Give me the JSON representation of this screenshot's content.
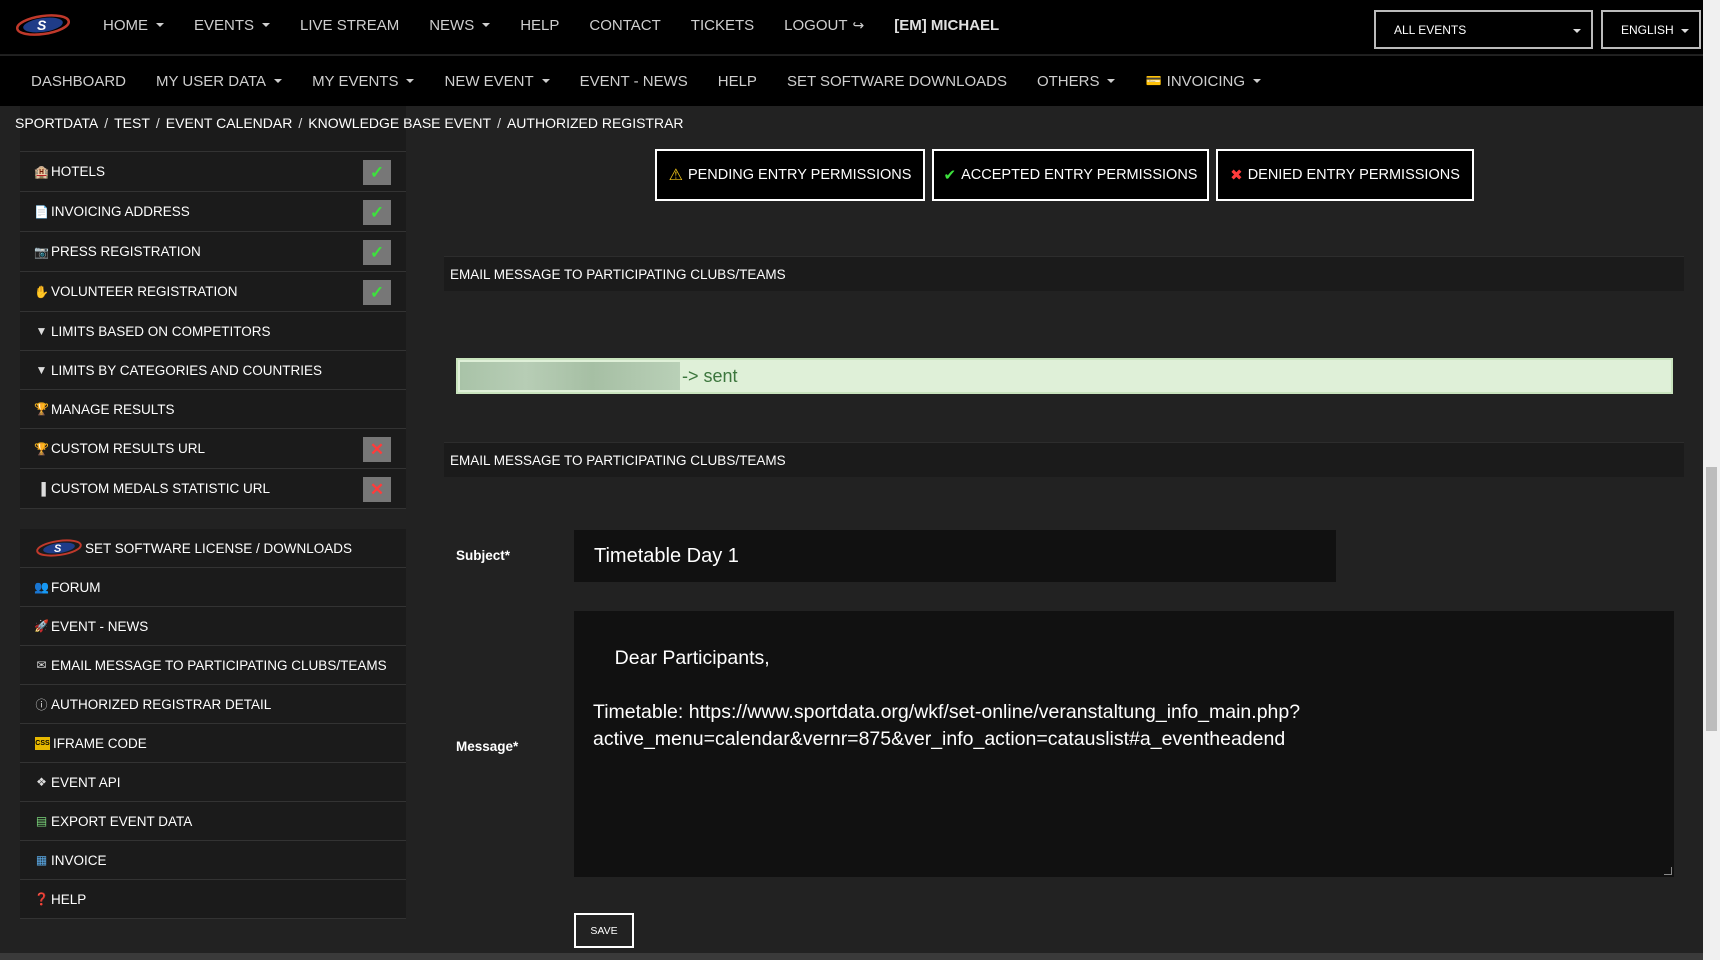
{
  "topnav": {
    "items": [
      {
        "label": "HOME",
        "dropdown": true
      },
      {
        "label": "EVENTS",
        "dropdown": true
      },
      {
        "label": "LIVE STREAM",
        "dropdown": false
      },
      {
        "label": "NEWS",
        "dropdown": true
      },
      {
        "label": "HELP",
        "dropdown": false
      },
      {
        "label": "CONTACT",
        "dropdown": false
      },
      {
        "label": "TICKETS",
        "dropdown": false
      },
      {
        "label": "LOGOUT",
        "dropdown": false
      },
      {
        "label": "[EM] MICHAEL",
        "dropdown": false
      }
    ],
    "event_select": "ALL EVENTS",
    "language_select": "ENGLISH"
  },
  "subnav": {
    "items": [
      {
        "label": "DASHBOARD",
        "dropdown": false
      },
      {
        "label": "MY USER DATA",
        "dropdown": true
      },
      {
        "label": "MY EVENTS",
        "dropdown": true
      },
      {
        "label": "NEW EVENT",
        "dropdown": true
      },
      {
        "label": "EVENT - NEWS",
        "dropdown": false
      },
      {
        "label": "HELP",
        "dropdown": false
      },
      {
        "label": "SET SOFTWARE DOWNLOADS",
        "dropdown": false
      },
      {
        "label": "OTHERS",
        "dropdown": true
      },
      {
        "label": "INVOICING",
        "dropdown": true
      }
    ]
  },
  "breadcrumb": [
    "SPORTDATA",
    "TEST",
    "EVENT CALENDAR",
    "KNOWLEDGE BASE EVENT",
    "AUTHORIZED REGISTRAR"
  ],
  "sidebar": {
    "group1": [
      {
        "label": "HOTELS",
        "icon": "hotel-icon",
        "status": "ok"
      },
      {
        "label": "INVOICING ADDRESS",
        "icon": "document-icon",
        "status": "ok"
      },
      {
        "label": "PRESS REGISTRATION",
        "icon": "camera-icon",
        "status": "ok"
      },
      {
        "label": "VOLUNTEER REGISTRATION",
        "icon": "hand-icon",
        "status": "ok"
      },
      {
        "label": "LIMITS BASED ON COMPETITORS",
        "icon": "filter-icon",
        "status": ""
      },
      {
        "label": "LIMITS BY CATEGORIES AND COUNTRIES",
        "icon": "filter-icon",
        "status": ""
      },
      {
        "label": "MANAGE RESULTS",
        "icon": "trophy-icon",
        "status": ""
      },
      {
        "label": "CUSTOM RESULTS URL",
        "icon": "trophy-icon",
        "status": "no"
      },
      {
        "label": "CUSTOM MEDALS STATISTIC URL",
        "icon": "bar-chart-icon",
        "status": "no"
      }
    ],
    "group2": [
      {
        "label": "SET SOFTWARE LICENSE / DOWNLOADS",
        "icon": "set-logo-icon"
      },
      {
        "label": "FORUM",
        "icon": "forum-icon"
      },
      {
        "label": "EVENT - NEWS",
        "icon": "rocket-icon"
      },
      {
        "label": "EMAIL MESSAGE TO PARTICIPATING CLUBS/TEAMS",
        "icon": "envelope-icon"
      },
      {
        "label": "AUTHORIZED REGISTRAR DETAIL",
        "icon": "info-icon"
      },
      {
        "label": "IFRAME CODE",
        "icon": "css-icon"
      },
      {
        "label": "EVENT API",
        "icon": "puzzle-icon"
      },
      {
        "label": "EXPORT EVENT DATA",
        "icon": "database-icon"
      },
      {
        "label": "INVOICE",
        "icon": "table-icon"
      },
      {
        "label": "HELP",
        "icon": "help-icon"
      }
    ]
  },
  "permissions": {
    "pending": "PENDING ENTRY PERMISSIONS",
    "accepted": "ACCEPTED ENTRY PERMISSIONS",
    "denied": "DENIED ENTRY PERMISSIONS"
  },
  "panel1_title": "EMAIL MESSAGE TO PARTICIPATING CLUBS/TEAMS",
  "alert_text": "-> sent",
  "panel2_title": "EMAIL MESSAGE TO PARTICIPATING CLUBS/TEAMS",
  "form": {
    "subject_label": "Subject*",
    "subject_value": "Timetable Day 1",
    "message_label": "Message*",
    "message_value": "Dear Participants,\n\nTimetable: https://www.sportdata.org/wkf/set-online/veranstaltung_info_main.php?\nactive_menu=calendar&vernr=875&ver_info_action=catauslist#a_eventheadend",
    "save_label": "SAVE"
  },
  "colors": {
    "ok": "#3de23d",
    "no": "#ff3b3b",
    "alert_bg": "#dff0d8",
    "alert_text": "#3c763d"
  }
}
